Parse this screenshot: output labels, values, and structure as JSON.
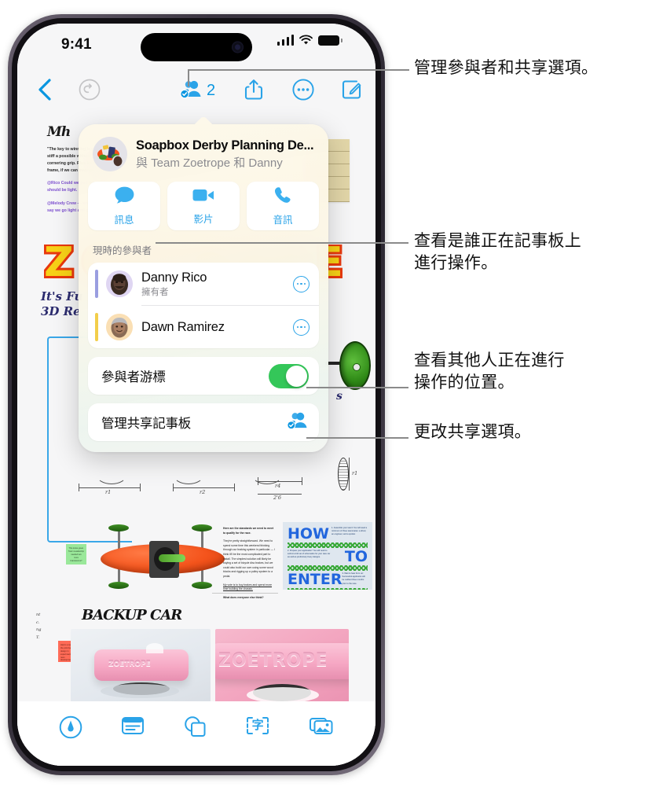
{
  "status_bar": {
    "time": "9:41",
    "signal_icon": "cellular-bars-icon",
    "wifi_icon": "wifi-icon",
    "battery_icon": "battery-full-icon"
  },
  "nav_bar": {
    "back_icon": "chevron-left-icon",
    "undo_icon": "undo-arrow-icon",
    "collab_icon": "collaboration-people-icon",
    "collab_count": "2",
    "share_icon": "share-up-arrow-icon",
    "more_icon": "more-ellipsis-circle-icon",
    "compose_icon": "compose-pencil-square-icon"
  },
  "popover": {
    "avatar_icon": "group-avatar-icon",
    "title": "Soapbox Derby Planning De...",
    "subtitle": "與 Team Zoetrope 和 Danny",
    "quick_actions": [
      {
        "icon": "message-bubble-icon",
        "label": "訊息"
      },
      {
        "icon": "video-camera-icon",
        "label": "影片"
      },
      {
        "icon": "phone-handset-icon",
        "label": "音訊"
      }
    ],
    "section_label": "現時的參與者",
    "participants": [
      {
        "name": "Danny Rico",
        "role": "擁有者",
        "bar_color": "#9a9ee0",
        "avatar_bg": "#dfd6f2",
        "more_icon": "more-ellipsis-circle-icon"
      },
      {
        "name": "Dawn Ramirez",
        "role": "",
        "bar_color": "#f2ce4a",
        "avatar_bg": "#fadfb4",
        "more_icon": "more-ellipsis-circle-icon"
      }
    ],
    "cursor_option": {
      "label": "參與者游標",
      "toggle_on": true,
      "toggle_color": "#34c759"
    },
    "manage_option": {
      "label": "管理共享記事板",
      "icon": "collaboration-people-icon"
    }
  },
  "canvas": {
    "doc_title": "Mh",
    "doc_paragraphs": [
      "\"The key to winning is wheels that are as stiff a possible without compromising cornering grip. Plus less weight on the frame, if we can manage it, we upcycle.",
      "@Rico Could we pull this off? Wheels should be light.",
      "@Melody Crew — worth spending on. I say we go light and good structure."
    ],
    "logo_text": "ZOETROPE",
    "hand_note_1": "It's Fun\n3D Re...",
    "hand_note_s": "s",
    "sticky_yellow_note": "ruled note",
    "green_sticky_text": "This looks great. Team Leadership needed two more brainstorms?",
    "red_sticky_text": "Here's a render of the pink bar design in experimental resin development.",
    "doc2_paragraphs": [
      "Here are the standards we need to meet to qualify for the race.",
      "They're pretty straightforward. We need to spend some time this weekend thinking through our braking system in particular — I think it'll be the most complicated part to install. The simplest solution will likely be buying a set of bicycle disc brakes, but we could also build our own using some wood blocks and rigging up a pulley system to a pedal.",
      "My vote is to buy brakes and spend more time building the chassis.",
      "What does everyone else think?"
    ],
    "poster_words": [
      "HOW",
      "TO",
      "ENTER"
    ],
    "poster_small": [
      "1. Assemble your team! You will need a minimum of three teammates: a driver, an engineer, and a spotter.",
      "2. Prepare your application! You will need to submit a full set of schematics for your race car as well as preliminary livery designs.",
      "3. Wait to hear from us! Successful applicants will be notified three months prior to the race."
    ],
    "backup_title": "BACKUP CAR",
    "photo_label": "ZOETROPE",
    "dim_labels": [
      "r1",
      "r2",
      "r4",
      "2'6",
      "r1"
    ]
  },
  "toolbar": {
    "items": [
      {
        "icon": "markup-pen-circle-icon",
        "name": "markup-tool"
      },
      {
        "icon": "note-lines-icon",
        "name": "note-tool"
      },
      {
        "icon": "shapes-icon",
        "name": "shapes-tool"
      },
      {
        "icon": "text-box-icon",
        "name": "text-tool",
        "glyph": "字"
      },
      {
        "icon": "media-photos-icon",
        "name": "media-tool"
      }
    ]
  },
  "callouts": [
    {
      "id": "manage-participants",
      "text": "管理參與者和共享選項。"
    },
    {
      "id": "see-who-working",
      "line1": "查看是誰正在記事板上",
      "line2": "進行操作。"
    },
    {
      "id": "see-where-others",
      "line1": "查看其他人正在進行",
      "line2": "操作的位置。"
    },
    {
      "id": "change-share-options",
      "text": "更改共享選項。"
    }
  ]
}
